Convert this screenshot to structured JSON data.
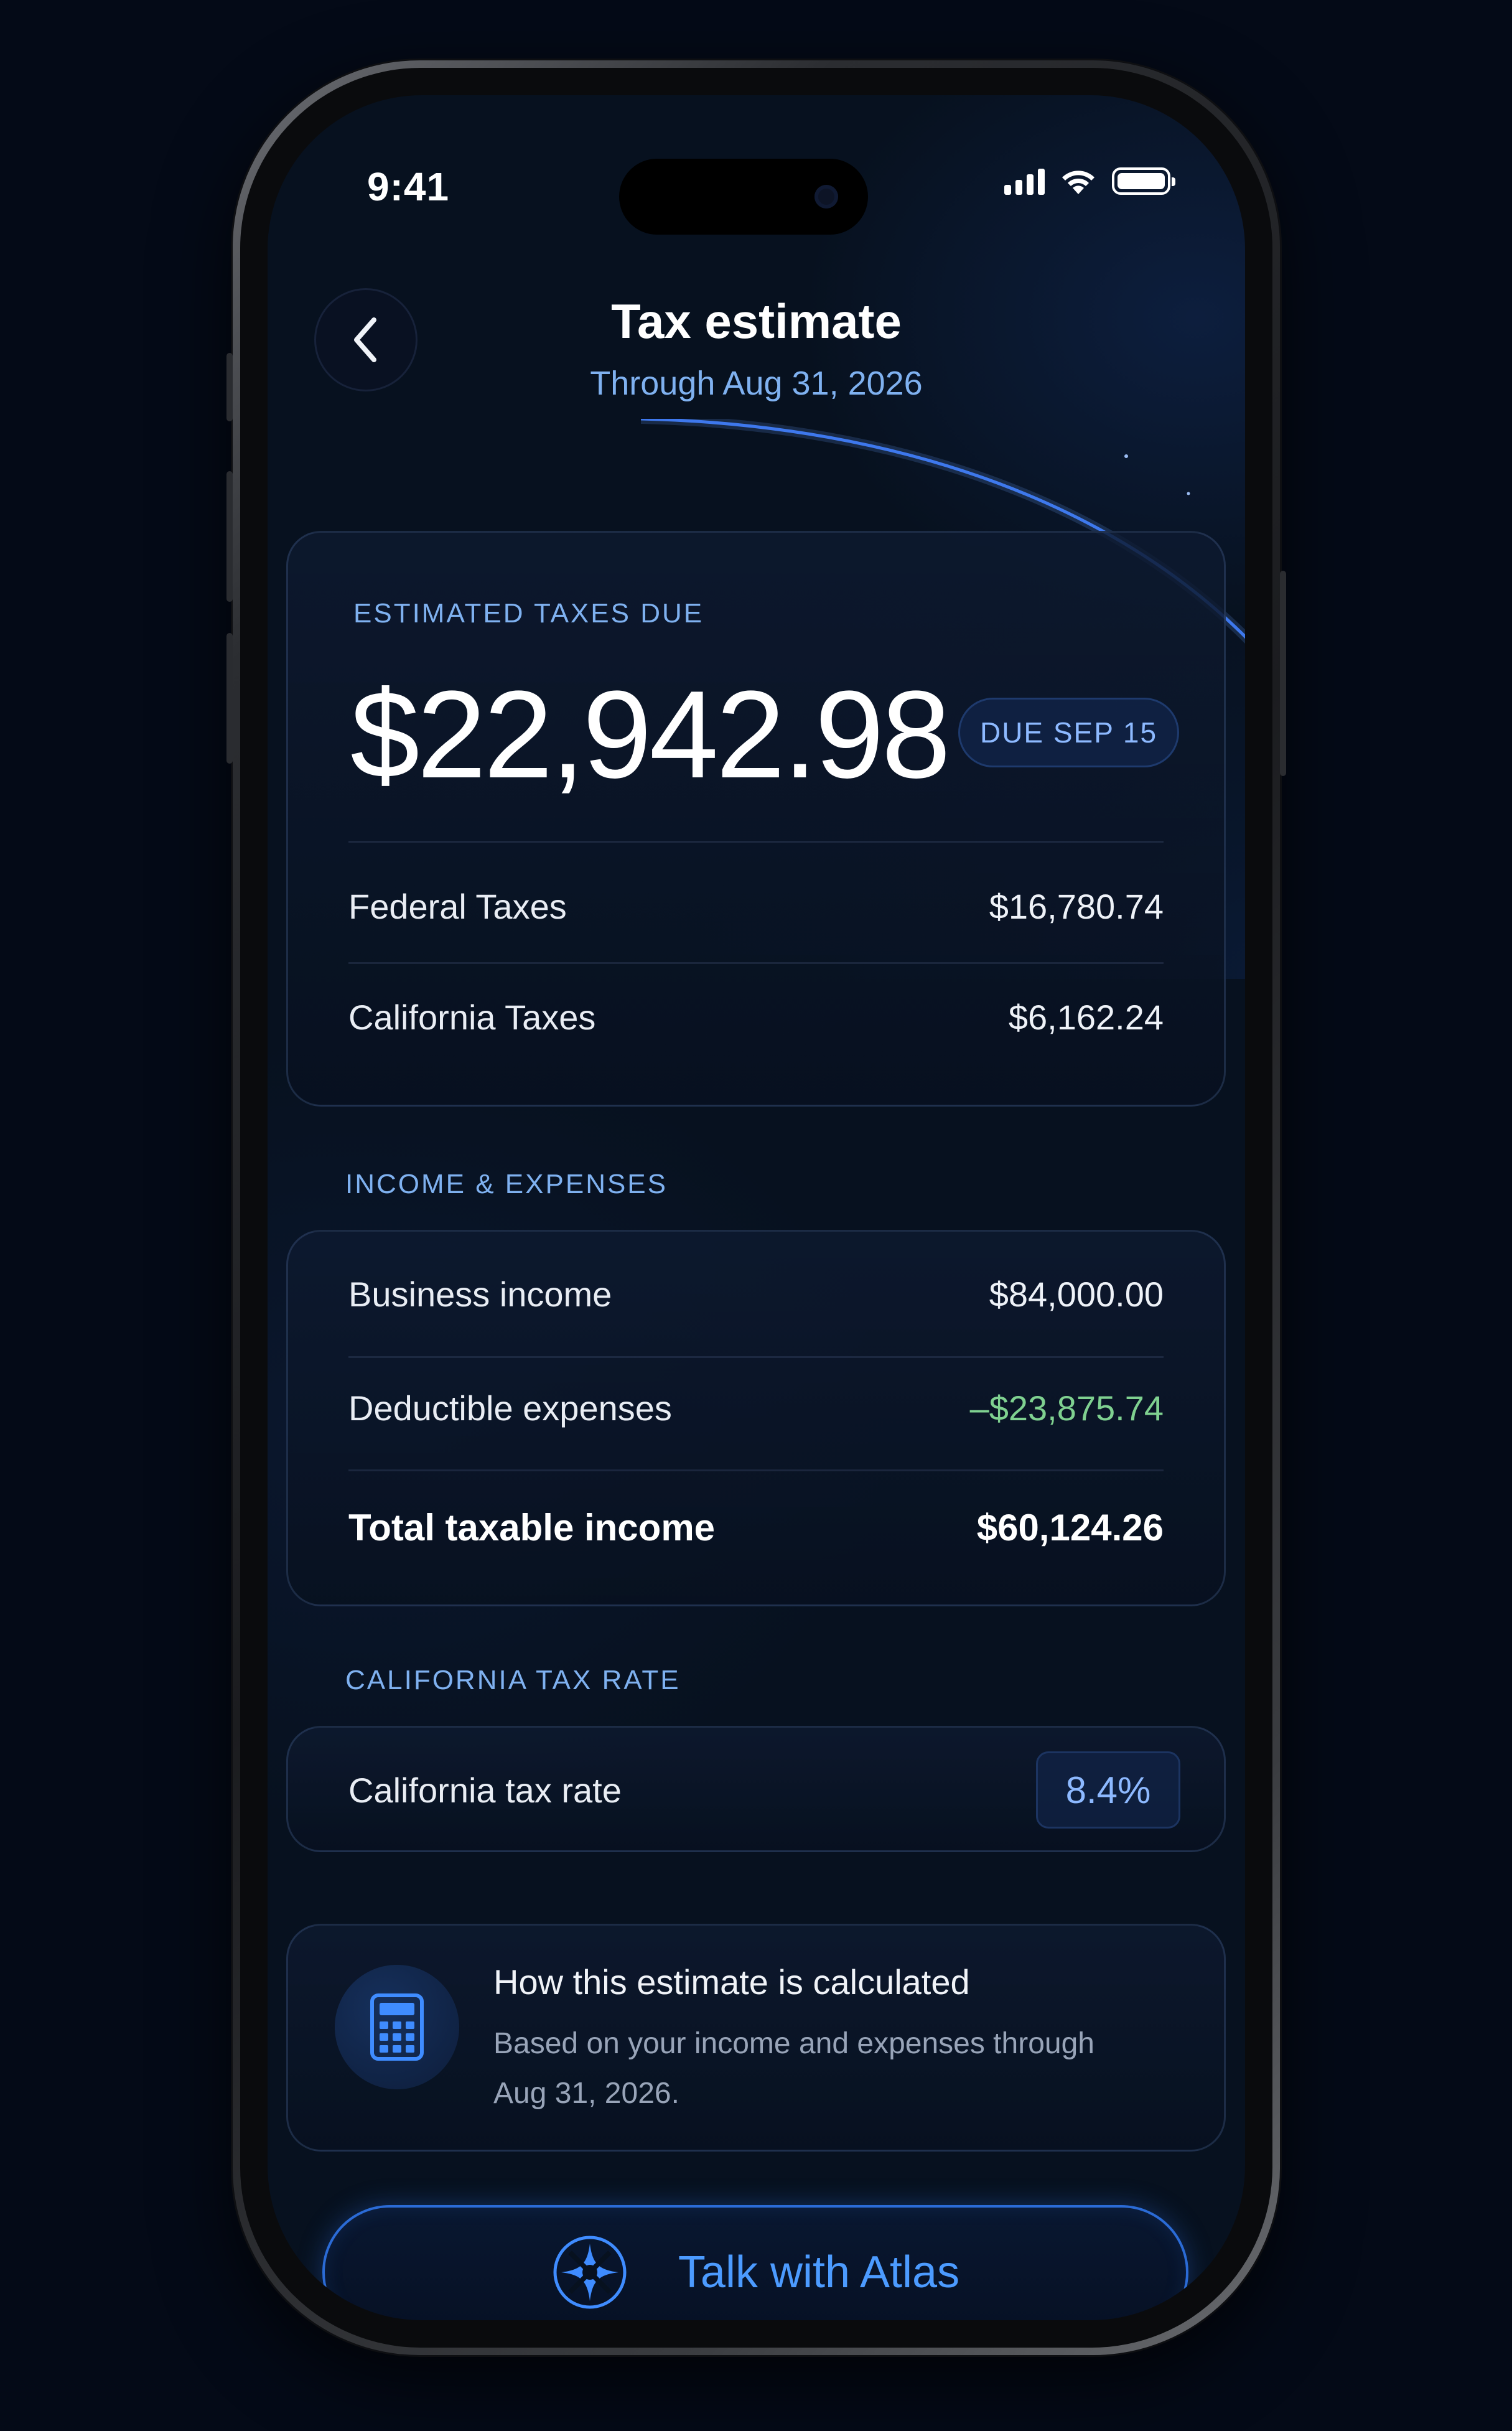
{
  "status_bar": {
    "time": "9:41"
  },
  "header": {
    "title": "Tax estimate",
    "subtitle": "Through Aug 31, 2026"
  },
  "summary": {
    "label": "ESTIMATED TAXES DUE",
    "amount": "$22,942.98",
    "due_badge": "DUE SEP 15",
    "rows": [
      {
        "label": "Federal Taxes",
        "value": "$16,780.74"
      },
      {
        "label": "California Taxes",
        "value": "$6,162.24"
      }
    ]
  },
  "income_expenses": {
    "section_label": "INCOME & EXPENSES",
    "rows": [
      {
        "label": "Business income",
        "value": "$84,000.00"
      },
      {
        "label": "Deductible expenses",
        "value": "–$23,875.74"
      },
      {
        "label": "Total taxable income",
        "value": "$60,124.26"
      }
    ]
  },
  "tax_rate": {
    "section_label": "CALIFORNIA TAX RATE",
    "label": "California tax rate",
    "value": "8.4%"
  },
  "info": {
    "icon": "calculator-icon",
    "title": "How this estimate is calculated",
    "body": "Based on your income and expenses through Aug 31, 2026."
  },
  "cta": {
    "icon": "atlas-logo-icon",
    "label": "Talk with Atlas"
  },
  "colors": {
    "background": "#07111f",
    "accent": "#4c9bff",
    "label_blue": "#7fb1f0",
    "negative_green": "#7fd190"
  }
}
